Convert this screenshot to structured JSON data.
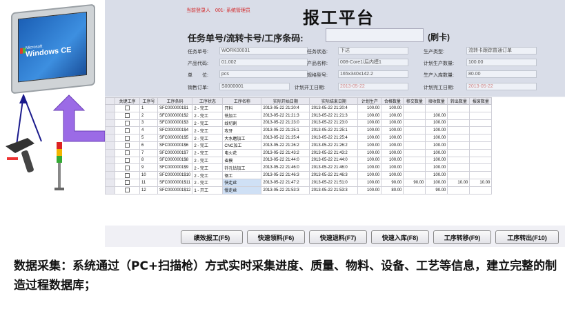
{
  "device": {
    "brand": "Microsoft",
    "os": "Windows CE"
  },
  "app": {
    "login_label": "当前登录人",
    "login_user": "001- 系统管理员",
    "title": "报工平台",
    "scan_label": "任务单号/流转卡号/工序条码:",
    "scan_value": "",
    "swipe_label": "(刷卡)",
    "fields": [
      {
        "label": "任务单号:",
        "value": "WORK00031"
      },
      {
        "label": "任务状态:",
        "value": "下达"
      },
      {
        "label": "生产类型:",
        "value": "流转卡跟踪普通订单"
      },
      {
        "label": "产品代码:",
        "value": "01.002"
      },
      {
        "label": "产品名称:",
        "value": "008-Core1/后内模1"
      },
      {
        "label": "计划生产数量:",
        "value": "100.00"
      },
      {
        "label": "单　　位:",
        "value": "pcs"
      },
      {
        "label": "规格型号:",
        "value": "165x340x142.2"
      },
      {
        "label": "生产入库数量:",
        "value": "80.00"
      },
      {
        "label": "销售订单:",
        "value": "S0000001"
      },
      {
        "label": "计划开工日期:",
        "value": "2013-05-22"
      },
      {
        "label": "计划完工日期:",
        "value": "2013-05-22"
      }
    ]
  },
  "table": {
    "headers": [
      "关键工序",
      "工序号",
      "工序条码",
      "工序状态",
      "工序名称",
      "实际开始日期",
      "实际结束日期",
      "计划生产",
      "合格数量",
      "移交数量",
      "接收数量",
      "转出数量",
      "报废数量"
    ],
    "rows": [
      [
        "",
        "1",
        "SFC0000001$1",
        "2 - 完工",
        "开料",
        "2013-05-22 21:20:4",
        "2013-05-22 21:20:4",
        "100.00",
        "100.00",
        "",
        "",
        "",
        ""
      ],
      [
        "",
        "2",
        "SFC0000001$2",
        "2 - 完工",
        "铣加工",
        "2013-05-22 21:21:3",
        "2013-05-22 21:21:3",
        "100.00",
        "100.00",
        "",
        "100.00",
        "",
        ""
      ],
      [
        "",
        "3",
        "SFC0000001$3",
        "2 - 完工",
        "线切割",
        "2013-05-22 21:23:0",
        "2013-05-22 21:23:0",
        "100.00",
        "100.00",
        "",
        "100.00",
        "",
        ""
      ],
      [
        "",
        "4",
        "SFC0000001$4",
        "2 - 完工",
        "攻牙",
        "2013-05-22 21:25:1",
        "2013-05-22 21:25:1",
        "100.00",
        "100.00",
        "",
        "100.00",
        "",
        ""
      ],
      [
        "",
        "5",
        "SFC0000001$5",
        "2 - 完工",
        "大水磨加工",
        "2013-05-22 21:25:4",
        "2013-05-22 21:25:4",
        "100.00",
        "100.00",
        "",
        "100.00",
        "",
        ""
      ],
      [
        "",
        "6",
        "SFC0000001$6",
        "2 - 完工",
        "CNC加工",
        "2013-05-22 21:26:2",
        "2013-05-22 21:26:2",
        "100.00",
        "100.00",
        "",
        "100.00",
        "",
        ""
      ],
      [
        "",
        "7",
        "SFC0000001$7",
        "2 - 完工",
        "电火花",
        "2013-05-22 21:43:2",
        "2013-05-22 21:43:2",
        "100.00",
        "100.00",
        "",
        "100.00",
        "",
        ""
      ],
      [
        "",
        "8",
        "SFC0000001$8",
        "2 - 完工",
        "省模",
        "2013-05-22 21:44:0",
        "2013-05-22 21:44:0",
        "100.00",
        "100.00",
        "",
        "100.00",
        "",
        ""
      ],
      [
        "",
        "9",
        "SFC0000001$9",
        "2 - 完工",
        "钎孔钻加工",
        "2013-05-22 21:46:0",
        "2013-05-22 21:46:0",
        "100.00",
        "100.00",
        "",
        "100.00",
        "",
        ""
      ],
      [
        "",
        "10",
        "SFC0000001$10",
        "2 - 完工",
        "钢工",
        "2013-05-22 21:46:3",
        "2013-05-22 21:46:3",
        "100.00",
        "100.00",
        "",
        "100.00",
        "",
        ""
      ],
      [
        "",
        "11",
        "SFC0000001$11",
        "2 - 完工",
        "快走丝",
        "2013-05-22 21:47:2",
        "2013-05-22 21:51:0",
        "100.00",
        "90.00",
        "90.00",
        "100.00",
        "10.00",
        "10.00",
        ""
      ],
      [
        "",
        "12",
        "SFC0000001$12",
        "1 - 开工",
        "慢走丝",
        "2013-05-22 21:53:3",
        "2013-05-22 21:53:3",
        "100.00",
        "80.00",
        "",
        "90.00",
        "",
        "",
        ""
      ]
    ]
  },
  "buttons": [
    "绩效报工(F5)",
    "快速领料(F6)",
    "快速退料(F7)",
    "快速入库(F8)",
    "工序转移(F9)",
    "工序转出(F10)"
  ],
  "caption": "数据采集：系统通过（PC+扫描枪）方式实时采集进度、质量、物料、设备、工艺等信息，建立完整的制造过程数据库；",
  "colors": {
    "arrow": "#9b6be6",
    "line": "#1a1a8c",
    "login_text": "#d32020"
  }
}
